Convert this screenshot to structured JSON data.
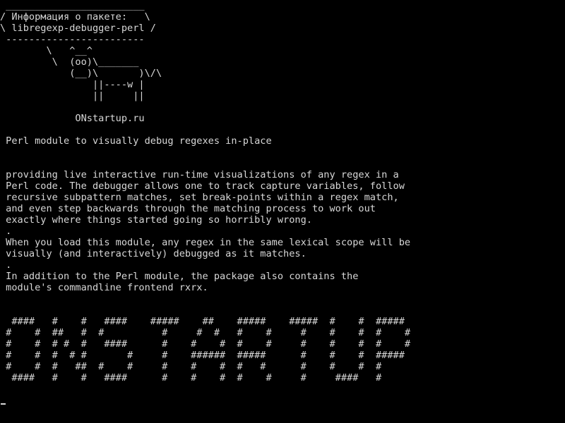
{
  "terminal": {
    "colors": {
      "background": "#000000",
      "foreground": "#d8d8d8"
    },
    "lines": [
      " ________________________",
      "/ Информация о пакете:   \\",
      "\\ libregexp-debugger-perl /",
      " ------------------------",
      "        \\   ^__^",
      "         \\  (oo)\\_______",
      "            (__)\\       )\\/\\",
      "                ||----w |",
      "                ||     ||",
      "",
      "             ONstartup.ru",
      "",
      " Perl module to visually debug regexes in-place",
      "",
      "",
      " providing live interactive run-time visualizations of any regex in a",
      " Perl code. The debugger allows one to track capture variables, follow",
      " recursive subpattern matches, set break-points within a regex match,",
      " and even step backwards through the matching process to work out",
      " exactly where things started going so horribly wrong.",
      " .",
      " When you load this module, any regex in the same lexical scope will be",
      " visually (and interactively) debugged as it matches.",
      " .",
      " In addition to the Perl module, the package also contains the",
      " module's commandline frontend rxrx.",
      "",
      "",
      "  ####   #    #   ####    #####    ##    #####    #####  #    #  #####",
      " #    #  ##   #  #          #     #  #   #    #     #    #    #  #    #",
      " #    #  # #  #   ####      #    #    #  #    #     #    #    #  #    #",
      " #    #  #  # #       #     #    ######  #####      #    #    #  #####",
      " #    #  #   ##  #    #     #    #    #  #   #      #    #    #  #",
      "  ####   #    #   ####      #    #    #  #    #     #     ####   #",
      "",
      ""
    ]
  }
}
